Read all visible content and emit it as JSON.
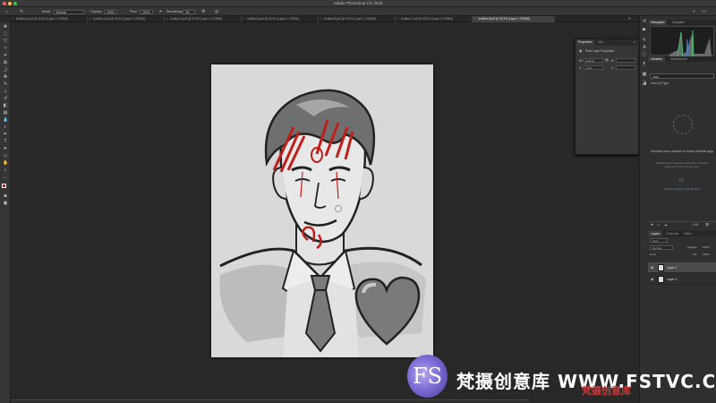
{
  "app": {
    "title": "Adobe Photoshop CC 2018"
  },
  "options_bar": {
    "mode_label": "Mode:",
    "mode_value": "Normal",
    "opacity_label": "Opacity:",
    "opacity_value": "100%",
    "flow_label": "Flow:",
    "flow_value": "100%",
    "smoothing_label": "Smoothing:",
    "smoothing_value": "0%"
  },
  "tabs": [
    {
      "label": "Untitled-2.pdf @ 33.3% (Layer 2, RGB/8)"
    },
    {
      "label": "Untitled-3.pdf @ 33.3% (Layer 2, RGB/8)"
    },
    {
      "label": "Untitled-4.pdf @ 33.3% (Layer 2, RGB/8)"
    },
    {
      "label": "Untitled-5.pdf @ 33.3% (Layer 1, RGB/8)"
    },
    {
      "label": "Untitled-6.pdf @ 33.3% (Layer 2, RGB/8)"
    },
    {
      "label": "Untitled-7.pdf @ 33.3% (Layer 2, RGB/8)"
    },
    {
      "label": "Untitled-8.pdf @ 33.3% (Layer 2, RGB/8)"
    }
  ],
  "properties_panel": {
    "tab_properties": "Properties",
    "tab_info": "Info",
    "subtitle": "Pixel Layer Properties",
    "w_label": "W:",
    "w_value": "3.33 in",
    "h_label": "H:",
    "h_value": "",
    "x_label": "X:",
    "x_value": "1.6 in",
    "y_label": "Y:",
    "y_value": ""
  },
  "right_panel": {
    "tab_histogram": "Histogram",
    "tab_navigator": "Navigator",
    "tab_libraries": "Libraries",
    "tab_adjustments": "Adjustments",
    "library_name": "Jack",
    "view_by": "View by Type",
    "message": "Access your assets in every Adobe app",
    "small_text": "Drag and drop images or add colors, character styles and more from your app.",
    "link": "Create new layer from all apps",
    "tab_layers": "Layers",
    "tab_channels": "Channels",
    "tab_paths": "Paths",
    "kind_label": "Kind",
    "blend_mode": "Normal",
    "opacity_label": "Opacity:",
    "opacity_value": "100%",
    "lock_label": "Lock:",
    "fill_label": "Fill:",
    "fill_value": "100%",
    "size_value": "-- KB",
    "layers": [
      {
        "name": "Layer 2",
        "selected": true
      },
      {
        "name": "Layer 1",
        "selected": false
      }
    ]
  },
  "watermark": {
    "logo_text": "FS",
    "brand_text": "梵摄创意库 WWW.FSTVC.CC",
    "red_text": "梵摄创意库"
  },
  "colors": {
    "ui_dark": "#282828",
    "panel": "#2f2f2f",
    "accent_red": "#c0201a",
    "link_blue": "#5b9bd5"
  }
}
